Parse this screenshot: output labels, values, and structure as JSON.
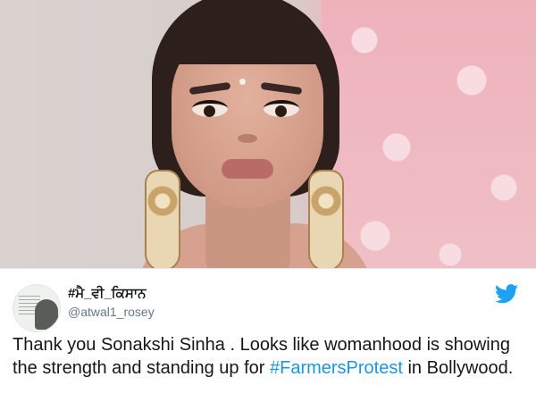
{
  "tweet": {
    "display_name": "#ਮੈ_ਵੀ_ਕਿਸਾਨ",
    "handle": "@atwal1_rosey",
    "text_before": "Thank you Sonakshi Sinha . Looks like womanhood is showing the strength and standing up for ",
    "hashtag": "#FarmersProtest",
    "text_after": " in Bollywood."
  },
  "icons": {
    "platform": "twitter-bird-icon",
    "avatar": "avatar-image"
  },
  "colors": {
    "hashtag": "#1b95e0",
    "twitter_blue": "#1da1f2",
    "text": "#14171a",
    "secondary_text": "#657786"
  }
}
